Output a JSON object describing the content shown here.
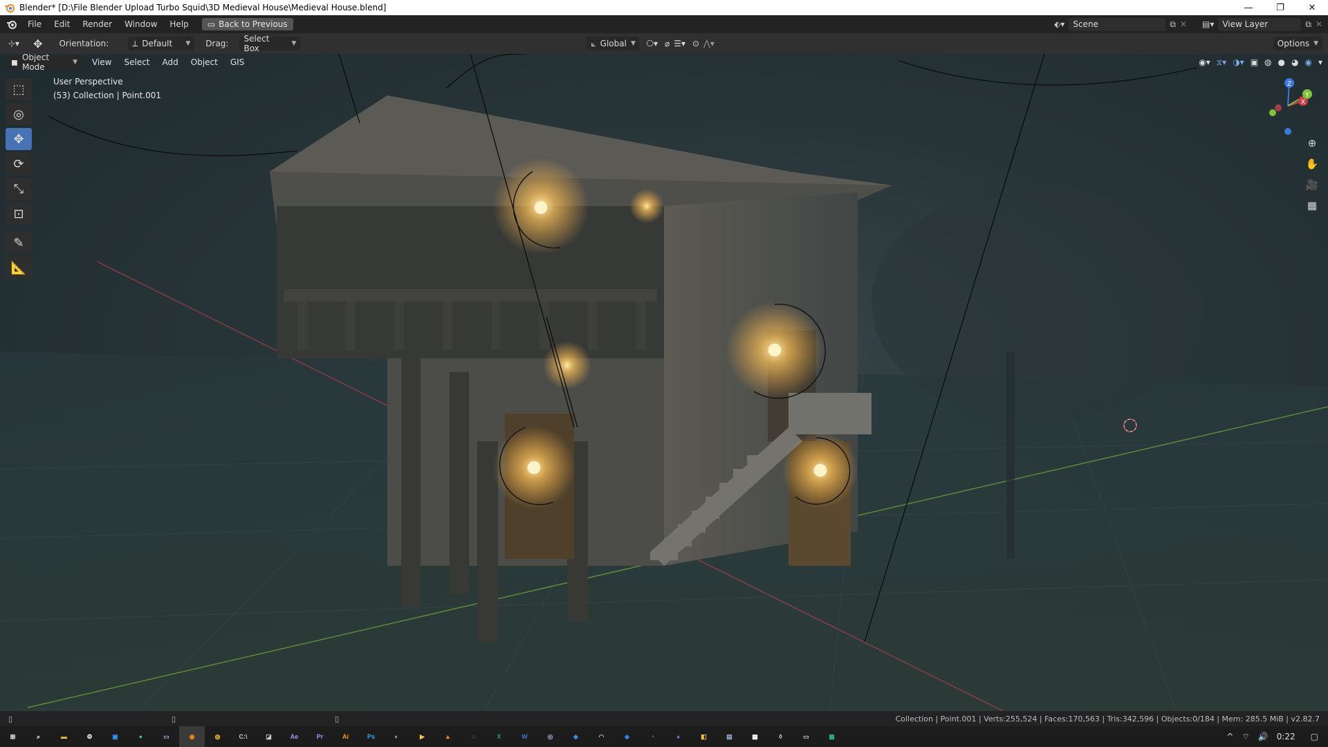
{
  "window": {
    "title": "Blender* [D:\\File Blender Upload Turbo Squid\\3D Medieval House\\Medieval House.blend]",
    "minimize": "—",
    "restore": "❐",
    "close": "✕"
  },
  "topbar": {
    "menus": [
      "File",
      "Edit",
      "Render",
      "Window",
      "Help"
    ],
    "back_button": "Back to Previous",
    "scene_label": "Scene",
    "view_layer_label": "View Layer"
  },
  "tool_header": {
    "orientation_label": "Orientation:",
    "orientation_value": "Default",
    "drag_label": "Drag:",
    "drag_value": "Select Box",
    "transform_orientation": "Global",
    "options_label": "Options"
  },
  "viewport_header": {
    "mode": "Object Mode",
    "menus": [
      "View",
      "Select",
      "Add",
      "Object",
      "GIS"
    ]
  },
  "viewport": {
    "perspective_label": "User Perspective",
    "collection_label": "(53) Collection | Point.001",
    "gizmo_axes": {
      "x": "X",
      "y": "Y",
      "z": "Z"
    }
  },
  "toolbar": {
    "tools": [
      "select-box",
      "cursor",
      "move",
      "rotate",
      "scale",
      "transform",
      "annotate",
      "measure"
    ],
    "active_tool": "move"
  },
  "statusbar": {
    "stats": "Collection | Point.001 | Verts:255,524 | Faces:170,563 | Tris:342,596 | Objects:0/184 | Mem: 285.5 MiB | v2.82.7"
  },
  "taskbar": {
    "apps": [
      {
        "name": "start",
        "glyph": "⊞",
        "color": "#ffffff"
      },
      {
        "name": "search",
        "glyph": "⌕",
        "color": "#ffffff"
      },
      {
        "name": "file-explorer",
        "glyph": "▬",
        "color": "#f2c244"
      },
      {
        "name": "settings",
        "glyph": "⚙",
        "color": "#ffffff"
      },
      {
        "name": "store",
        "glyph": "▣",
        "color": "#3a8ee6"
      },
      {
        "name": "whatsapp",
        "glyph": "●",
        "color": "#25d366"
      },
      {
        "name": "taskview",
        "glyph": "▭",
        "color": "#9fb4d8"
      },
      {
        "name": "blender",
        "glyph": "◉",
        "color": "#f08a24"
      },
      {
        "name": "chrome",
        "glyph": "◍",
        "color": "#e9b22f"
      },
      {
        "name": "terminal",
        "glyph": "C:\\",
        "color": "#cccccc"
      },
      {
        "name": "tool",
        "glyph": "◪",
        "color": "#cccccc"
      },
      {
        "name": "after-effects",
        "glyph": "Ae",
        "color": "#9999ff"
      },
      {
        "name": "premiere",
        "glyph": "Pr",
        "color": "#9999ff"
      },
      {
        "name": "illustrator",
        "glyph": "Ai",
        "color": "#ff9a00"
      },
      {
        "name": "photoshop",
        "glyph": "Ps",
        "color": "#31a8ff"
      },
      {
        "name": "app-15",
        "glyph": "◐",
        "color": "#cccccc"
      },
      {
        "name": "app-16",
        "glyph": "▶",
        "color": "#f2c244"
      },
      {
        "name": "vlc",
        "glyph": "▲",
        "color": "#f08a24"
      },
      {
        "name": "app-18",
        "glyph": "◌",
        "color": "#cccccc"
      },
      {
        "name": "excel",
        "glyph": "X",
        "color": "#21a366"
      },
      {
        "name": "word",
        "glyph": "W",
        "color": "#2b7cd3"
      },
      {
        "name": "steam",
        "glyph": "◎",
        "color": "#9fb4d8"
      },
      {
        "name": "app-22",
        "glyph": "◆",
        "color": "#3a8ee6"
      },
      {
        "name": "app-23",
        "glyph": "◠",
        "color": "#cccccc"
      },
      {
        "name": "app-24",
        "glyph": "◈",
        "color": "#3a8ee6"
      },
      {
        "name": "edge",
        "glyph": "◔",
        "color": "#2fb36f"
      },
      {
        "name": "app-26",
        "glyph": "◕",
        "color": "#8a7cf0"
      },
      {
        "name": "app-27",
        "glyph": "◧",
        "color": "#f2c244"
      },
      {
        "name": "app-28",
        "glyph": "▤",
        "color": "#9fb4d8"
      },
      {
        "name": "calculator",
        "glyph": "▦",
        "color": "#ffffff"
      },
      {
        "name": "app-30",
        "glyph": "◊",
        "color": "#ffffff"
      },
      {
        "name": "app-31",
        "glyph": "▭",
        "color": "#cccccc"
      },
      {
        "name": "app-32",
        "glyph": "▩",
        "color": "#2fb36f"
      }
    ],
    "clock": "0:22",
    "tray_chevron": "^",
    "tray_network": "⌔",
    "tray_volume": "🔊",
    "tray_notifications": "▢"
  },
  "colors": {
    "active_tool": "#4772b3",
    "x_axis": "#c7404a",
    "y_axis": "#7ec23a",
    "z_axis": "#3a78e0",
    "light_glow": "#ffd36b"
  }
}
